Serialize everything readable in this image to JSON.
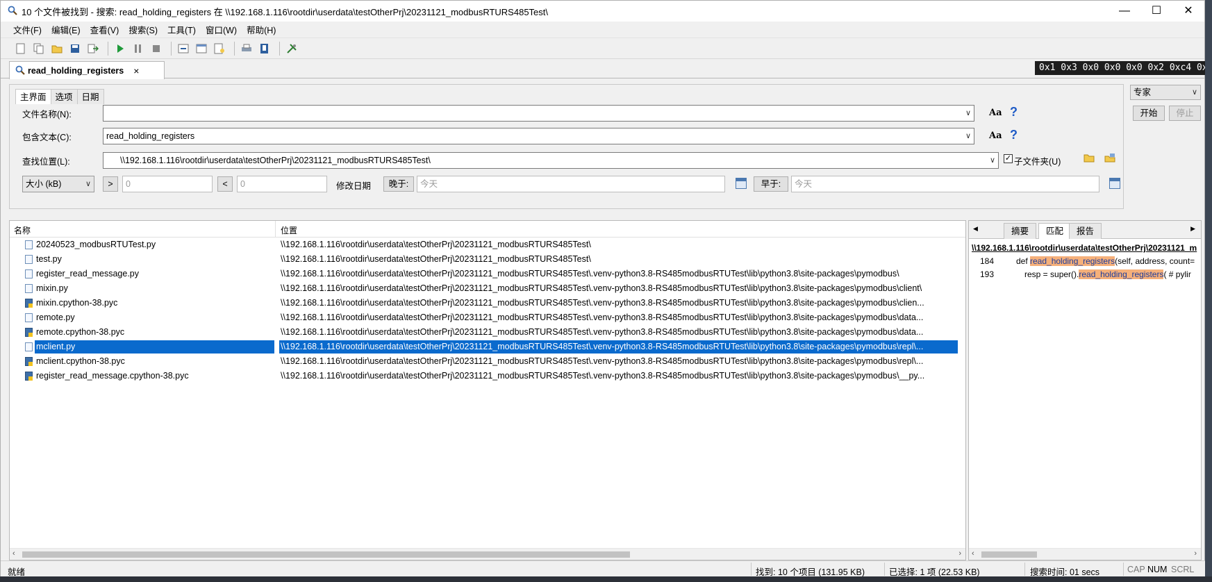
{
  "window": {
    "title": "10 个文件被找到 - 搜索: read_holding_registers 在 \\\\192.168.1.116\\rootdir\\userdata\\testOtherPrj\\20231121_modbusRTURS485Test\\",
    "minimize": "—",
    "maximize": "☐",
    "close": "✕"
  },
  "menu": [
    "文件(F)",
    "编辑(E)",
    "查看(V)",
    "搜索(S)",
    "工具(T)",
    "窗口(W)",
    "帮助(H)"
  ],
  "doc_tab": {
    "label": "read_holding_registers",
    "close": "×"
  },
  "hex_strip": "0x1 0x3 0x0 0x0 0x0 0x2 0xc4 0x",
  "search": {
    "subtabs": [
      "主界面",
      "选项",
      "日期"
    ],
    "filename_label": "文件名称(N):",
    "filename_value": "",
    "contains_label": "包含文本(C):",
    "contains_value": "read_holding_registers",
    "location_label": "查找位置(L):",
    "location_value": "\\\\192.168.1.116\\rootdir\\userdata\\testOtherPrj\\20231121_modbusRTURS485Test\\",
    "subfolder_label": "子文件夹(U)",
    "subfolder_checked": true,
    "aa_label": "Aa",
    "help_label": "?",
    "size_select": "大小 (kB)",
    "gt": ">",
    "lt": "<",
    "size_min": "0",
    "size_max": "0",
    "modified_label": "修改日期",
    "later_btn": "晚于:",
    "later_value": "今天",
    "earlier_btn": "早于:",
    "earlier_value": "今天",
    "mode_select": "专家",
    "start_btn": "开始",
    "stop_btn": "停止"
  },
  "results": {
    "col_name": "名称",
    "col_location": "位置",
    "rows": [
      {
        "name": "20240523_modbusRTUTest.py",
        "location": "\\\\192.168.1.116\\rootdir\\userdata\\testOtherPrj\\20231121_modbusRTURS485Test\\",
        "pyc": false
      },
      {
        "name": "test.py",
        "location": "\\\\192.168.1.116\\rootdir\\userdata\\testOtherPrj\\20231121_modbusRTURS485Test\\",
        "pyc": false
      },
      {
        "name": "register_read_message.py",
        "location": "\\\\192.168.1.116\\rootdir\\userdata\\testOtherPrj\\20231121_modbusRTURS485Test\\.venv-python3.8-RS485modbusRTUTest\\lib\\python3.8\\site-packages\\pymodbus\\",
        "pyc": false
      },
      {
        "name": "mixin.py",
        "location": "\\\\192.168.1.116\\rootdir\\userdata\\testOtherPrj\\20231121_modbusRTURS485Test\\.venv-python3.8-RS485modbusRTUTest\\lib\\python3.8\\site-packages\\pymodbus\\client\\",
        "pyc": false
      },
      {
        "name": "mixin.cpython-38.pyc",
        "location": "\\\\192.168.1.116\\rootdir\\userdata\\testOtherPrj\\20231121_modbusRTURS485Test\\.venv-python3.8-RS485modbusRTUTest\\lib\\python3.8\\site-packages\\pymodbus\\clien...",
        "pyc": true
      },
      {
        "name": "remote.py",
        "location": "\\\\192.168.1.116\\rootdir\\userdata\\testOtherPrj\\20231121_modbusRTURS485Test\\.venv-python3.8-RS485modbusRTUTest\\lib\\python3.8\\site-packages\\pymodbus\\data...",
        "pyc": false
      },
      {
        "name": "remote.cpython-38.pyc",
        "location": "\\\\192.168.1.116\\rootdir\\userdata\\testOtherPrj\\20231121_modbusRTURS485Test\\.venv-python3.8-RS485modbusRTUTest\\lib\\python3.8\\site-packages\\pymodbus\\data...",
        "pyc": true
      },
      {
        "name": "mclient.py",
        "location": "\\\\192.168.1.116\\rootdir\\userdata\\testOtherPrj\\20231121_modbusRTURS485Test\\.venv-python3.8-RS485modbusRTUTest\\lib\\python3.8\\site-packages\\pymodbus\\repl\\...",
        "pyc": false,
        "selected": true
      },
      {
        "name": "mclient.cpython-38.pyc",
        "location": "\\\\192.168.1.116\\rootdir\\userdata\\testOtherPrj\\20231121_modbusRTURS485Test\\.venv-python3.8-RS485modbusRTUTest\\lib\\python3.8\\site-packages\\pymodbus\\repl\\...",
        "pyc": true
      },
      {
        "name": "register_read_message.cpython-38.pyc",
        "location": "\\\\192.168.1.116\\rootdir\\userdata\\testOtherPrj\\20231121_modbusRTURS485Test\\.venv-python3.8-RS485modbusRTUTest\\lib\\python3.8\\site-packages\\pymodbus\\__py...",
        "pyc": true
      }
    ]
  },
  "side": {
    "tab_prev": "◀",
    "tab_next": "▶",
    "tabs": [
      "摘要",
      "匹配",
      "报告"
    ],
    "path": "\\\\192.168.1.116\\rootdir\\userdata\\testOtherPrj\\20231121_m",
    "matches": [
      {
        "line": "184",
        "before": "def ",
        "match": "read_holding_registers",
        "after": "(self, address, count="
      },
      {
        "line": "193",
        "before": "resp = super().",
        "match": "read_holding_registers",
        "after": "(  # pylir"
      }
    ]
  },
  "status": {
    "ready": "就绪",
    "found": "找到: 10 个项目 (131.95 KB)",
    "selected": "已选择: 1 项 (22.53 KB)",
    "time": "搜索时间: 01 secs",
    "cap": "CAP",
    "num": "NUM",
    "scrl": "SCRL"
  }
}
